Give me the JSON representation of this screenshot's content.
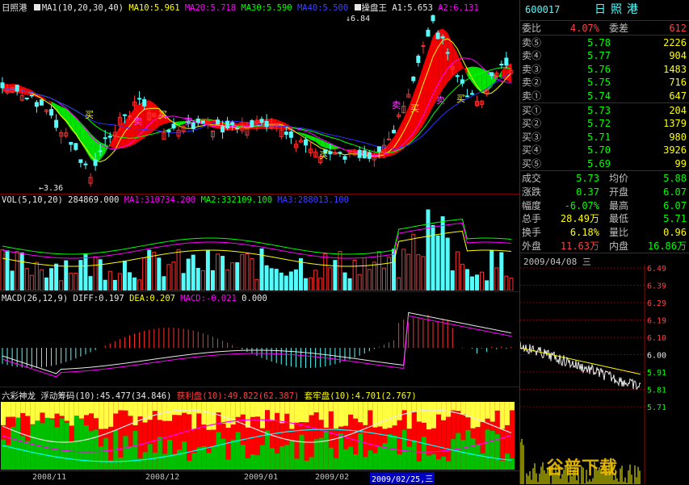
{
  "main_chart": {
    "stock_name": "日照港",
    "ma_params": "MA1(10,20,30,40)",
    "ma10": "MA10:5.961",
    "ma20": "MA20:5.718",
    "ma30": "MA30:5.590",
    "ma40": "MA40:5.500",
    "indicator_name": "操盘王",
    "a1": "A1:5.653",
    "a2": "A2:6.131",
    "high_label": "6.84",
    "low_label": "3.36",
    "signals": [
      "买",
      "卖",
      "买",
      "卖",
      "买",
      "卖",
      "买",
      "卖",
      "买"
    ]
  },
  "volume_panel": {
    "title": "VOL(5,10,20) 284869.000",
    "ma1": "MA1:310734.200",
    "ma2": "MA2:332109.100",
    "ma3": "MA3:288013.100"
  },
  "macd_panel": {
    "title": "MACD(26,12,9)",
    "diff": "DIFF:0.197",
    "dea": "DEA:0.207",
    "macd": "MACD:-0.021",
    "zero": "0.000"
  },
  "chip_panel": {
    "title": "六彩神龙 浮动筹码(10):45.477(34.846)",
    "profit": "获利盘(10):49.822(62.387)",
    "trapped": "套牢盘(10):4.701(2.767)"
  },
  "x_axis": {
    "labels": [
      "2008/11",
      "2008/12",
      "2009/01",
      "2009/02"
    ],
    "cursor_date": "2009/02/25,三"
  },
  "quote": {
    "code": "600017",
    "name": "日照港",
    "weibi_label": "委比",
    "weibi_value": "4.07%",
    "weicha_label": "委差",
    "weicha_value": "612",
    "sell": [
      {
        "label": "卖⑤",
        "price": "5.78",
        "vol": "2226"
      },
      {
        "label": "卖④",
        "price": "5.77",
        "vol": "904"
      },
      {
        "label": "卖③",
        "price": "5.76",
        "vol": "1483"
      },
      {
        "label": "卖②",
        "price": "5.75",
        "vol": "716"
      },
      {
        "label": "卖①",
        "price": "5.74",
        "vol": "647"
      }
    ],
    "buy": [
      {
        "label": "买①",
        "price": "5.73",
        "vol": "204"
      },
      {
        "label": "买②",
        "price": "5.72",
        "vol": "1379"
      },
      {
        "label": "买③",
        "price": "5.71",
        "vol": "980"
      },
      {
        "label": "买④",
        "price": "5.70",
        "vol": "3926"
      },
      {
        "label": "买⑤",
        "price": "5.69",
        "vol": "99"
      }
    ],
    "stats": [
      {
        "l1": "成交",
        "v1": "5.73",
        "l2": "均价",
        "v2": "5.88"
      },
      {
        "l1": "涨跌",
        "v1": "0.37",
        "l2": "开盘",
        "v2": "6.07"
      },
      {
        "l1": "幅度",
        "v1": "-6.07%",
        "l2": "最高",
        "v2": "6.07"
      },
      {
        "l1": "总手",
        "v1": "28.49万",
        "l2": "最低",
        "v2": "5.71"
      },
      {
        "l1": "换手",
        "v1": "6.18%",
        "l2": "量比",
        "v2": "0.96"
      },
      {
        "l1": "外盘",
        "v1": "11.63万",
        "l2": "内盘",
        "v2": "16.86万"
      }
    ]
  },
  "intraday": {
    "date": "2009/04/08 三",
    "ticks": [
      "6.49",
      "6.39",
      "6.29",
      "6.19",
      "6.10",
      "6.00",
      "5.91",
      "5.81",
      "5.71"
    ],
    "watermark": "谷普下载"
  },
  "colors": {
    "up": "#ff3030",
    "down": "#54fcfc",
    "grid": "#8b0000",
    "green_band": "#00ee00",
    "red_band": "#ff0000"
  }
}
